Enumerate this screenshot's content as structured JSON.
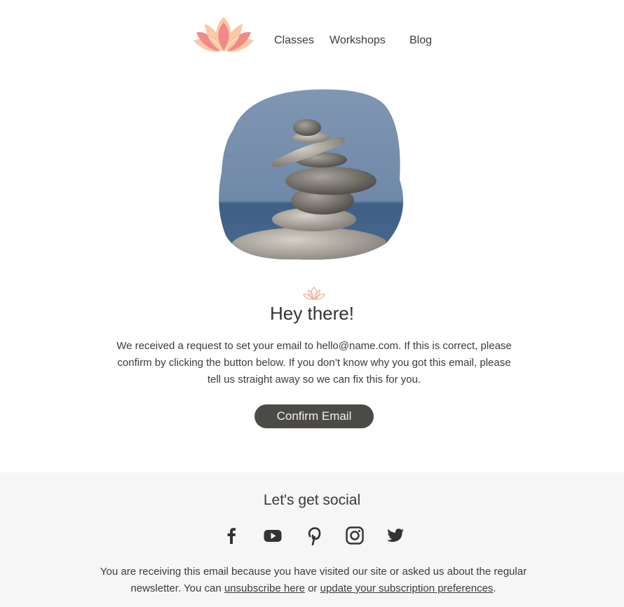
{
  "header": {
    "logo": "lotus-logo",
    "nav": [
      {
        "label": "Classes"
      },
      {
        "label": "Workshops"
      },
      {
        "label": "Blog"
      }
    ]
  },
  "hero": {
    "image": "stacked-stones-photo"
  },
  "main": {
    "title": "Hey there!",
    "body": "We received a request to set your email to hello@name.com. If this is correct, please confirm by clicking the button below. If you don’t know why you got this email, please tell us straight away so we can fix this for you.",
    "button_label": "Confirm Email"
  },
  "footer": {
    "social_title": "Let's get social",
    "social_icons": [
      "facebook-icon",
      "youtube-icon",
      "pinterest-icon",
      "instagram-icon",
      "twitter-icon"
    ],
    "text_prefix": "You are receiving this email because you have visited our site or asked us about the regular newsletter. You can ",
    "unsubscribe_label": "unsubscribe here",
    "text_middle": " or ",
    "preferences_label": "update your subscription preferences",
    "text_suffix": "."
  },
  "colors": {
    "accent_pink": "#f08080",
    "accent_peach": "#f9c8a4",
    "button_bg": "#4c4a47",
    "footer_bg": "#f6f6f6"
  }
}
